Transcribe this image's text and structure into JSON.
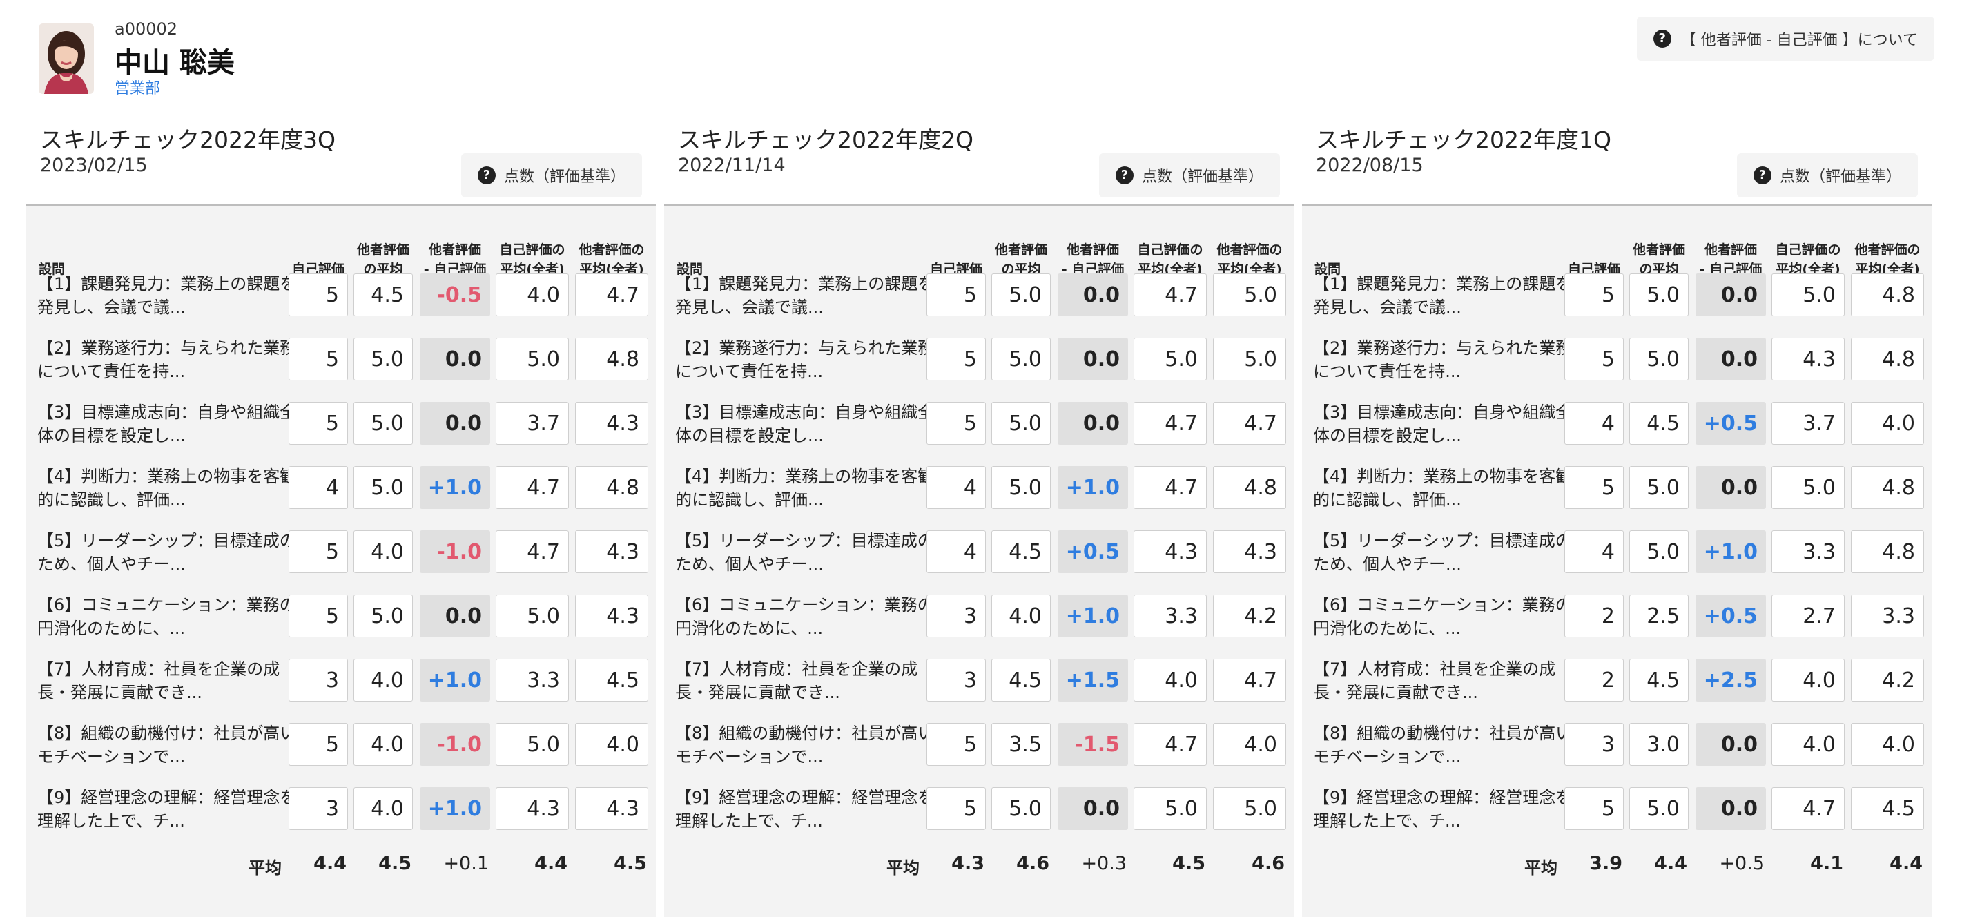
{
  "user": {
    "id": "a00002",
    "name": "中山 聡美",
    "department": "営業部"
  },
  "about_button": {
    "label": "【 他者評価 - 自己評価 】について"
  },
  "columns": {
    "question": "設問",
    "self": "自己評価",
    "others_avg_1": "他者評価",
    "others_avg_2": "の平均",
    "diff_1": "他者評価",
    "diff_2": "- 自己評価",
    "self_all_1": "自己評価の",
    "self_all_2": "平均(全者)",
    "others_all_1": "他者評価の",
    "others_all_2": "平均(全者)"
  },
  "criteria_button": {
    "label": "点数（評価基準）"
  },
  "average_label": "平均",
  "questions": [
    "【1】課題発見力：業務上の課題を発見し、会議で議...",
    "【2】業務遂行力：与えられた業務について責任を持...",
    "【3】目標達成志向：自身や組織全体の目標を設定し...",
    "【4】判断力：業務上の物事を客観的に認識し、評価...",
    "【5】リーダーシップ：目標達成のため、個人やチー...",
    "【6】コミュニケーション：業務の円滑化のために、...",
    "【7】人材育成：社員を企業の成長・発展に貢献でき...",
    "【8】組織の動機付け：社員が高いモチベーションで...",
    "【9】経営理念の理解：経営理念を理解した上で、チ..."
  ],
  "panels": [
    {
      "title": "スキルチェック2022年度3Q",
      "date": "2023/02/15",
      "rows": [
        {
          "self": "5",
          "others": "4.5",
          "diff": "-0.5",
          "self_all": "4.0",
          "others_all": "4.7"
        },
        {
          "self": "5",
          "others": "5.0",
          "diff": "0.0",
          "self_all": "5.0",
          "others_all": "4.8"
        },
        {
          "self": "5",
          "others": "5.0",
          "diff": "0.0",
          "self_all": "3.7",
          "others_all": "4.3"
        },
        {
          "self": "4",
          "others": "5.0",
          "diff": "+1.0",
          "self_all": "4.7",
          "others_all": "4.8"
        },
        {
          "self": "5",
          "others": "4.0",
          "diff": "-1.0",
          "self_all": "4.7",
          "others_all": "4.3"
        },
        {
          "self": "5",
          "others": "5.0",
          "diff": "0.0",
          "self_all": "5.0",
          "others_all": "4.3"
        },
        {
          "self": "3",
          "others": "4.0",
          "diff": "+1.0",
          "self_all": "3.3",
          "others_all": "4.5"
        },
        {
          "self": "5",
          "others": "4.0",
          "diff": "-1.0",
          "self_all": "5.0",
          "others_all": "4.0"
        },
        {
          "self": "3",
          "others": "4.0",
          "diff": "+1.0",
          "self_all": "4.3",
          "others_all": "4.3"
        }
      ],
      "average": {
        "self": "4.4",
        "others": "4.5",
        "diff": "+0.1",
        "self_all": "4.4",
        "others_all": "4.5"
      }
    },
    {
      "title": "スキルチェック2022年度2Q",
      "date": "2022/11/14",
      "rows": [
        {
          "self": "5",
          "others": "5.0",
          "diff": "0.0",
          "self_all": "4.7",
          "others_all": "5.0"
        },
        {
          "self": "5",
          "others": "5.0",
          "diff": "0.0",
          "self_all": "5.0",
          "others_all": "5.0"
        },
        {
          "self": "5",
          "others": "5.0",
          "diff": "0.0",
          "self_all": "4.7",
          "others_all": "4.7"
        },
        {
          "self": "4",
          "others": "5.0",
          "diff": "+1.0",
          "self_all": "4.7",
          "others_all": "4.8"
        },
        {
          "self": "4",
          "others": "4.5",
          "diff": "+0.5",
          "self_all": "4.3",
          "others_all": "4.3"
        },
        {
          "self": "3",
          "others": "4.0",
          "diff": "+1.0",
          "self_all": "3.3",
          "others_all": "4.2"
        },
        {
          "self": "3",
          "others": "4.5",
          "diff": "+1.5",
          "self_all": "4.0",
          "others_all": "4.7"
        },
        {
          "self": "5",
          "others": "3.5",
          "diff": "-1.5",
          "self_all": "4.7",
          "others_all": "4.0"
        },
        {
          "self": "5",
          "others": "5.0",
          "diff": "0.0",
          "self_all": "5.0",
          "others_all": "5.0"
        }
      ],
      "average": {
        "self": "4.3",
        "others": "4.6",
        "diff": "+0.3",
        "self_all": "4.5",
        "others_all": "4.6"
      }
    },
    {
      "title": "スキルチェック2022年度1Q",
      "date": "2022/08/15",
      "rows": [
        {
          "self": "5",
          "others": "5.0",
          "diff": "0.0",
          "self_all": "5.0",
          "others_all": "4.8"
        },
        {
          "self": "5",
          "others": "5.0",
          "diff": "0.0",
          "self_all": "4.3",
          "others_all": "4.8"
        },
        {
          "self": "4",
          "others": "4.5",
          "diff": "+0.5",
          "self_all": "3.7",
          "others_all": "4.0"
        },
        {
          "self": "5",
          "others": "5.0",
          "diff": "0.0",
          "self_all": "5.0",
          "others_all": "4.8"
        },
        {
          "self": "4",
          "others": "5.0",
          "diff": "+1.0",
          "self_all": "3.3",
          "others_all": "4.8"
        },
        {
          "self": "2",
          "others": "2.5",
          "diff": "+0.5",
          "self_all": "2.7",
          "others_all": "3.3"
        },
        {
          "self": "2",
          "others": "4.5",
          "diff": "+2.5",
          "self_all": "4.0",
          "others_all": "4.2"
        },
        {
          "self": "3",
          "others": "3.0",
          "diff": "0.0",
          "self_all": "4.0",
          "others_all": "4.0"
        },
        {
          "self": "5",
          "others": "5.0",
          "diff": "0.0",
          "self_all": "4.7",
          "others_all": "4.5"
        }
      ],
      "average": {
        "self": "3.9",
        "others": "4.4",
        "diff": "+0.5",
        "self_all": "4.1",
        "others_all": "4.4"
      }
    }
  ],
  "colors": {
    "positive": "#2f7de0",
    "negative": "#e2596f",
    "accent_link": "#2f7de0"
  },
  "icons": {
    "help": "question-circle-icon"
  }
}
